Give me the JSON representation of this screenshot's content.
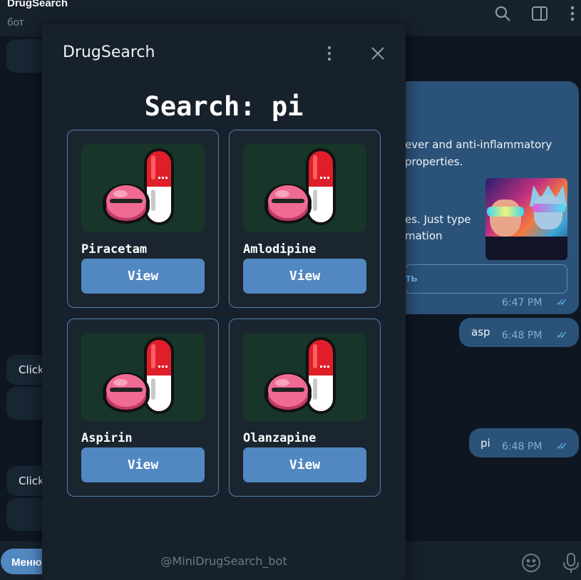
{
  "telegram": {
    "chat_title": "DrugSearch",
    "chat_subtitle": "бот",
    "header_icons": [
      "search-icon",
      "sidebar-toggle-icon",
      "more-vertical-icon"
    ]
  },
  "chat": {
    "bot_message_lines": [
      "ever and anti-inflammatory",
      "properties.",
      "es. Just type",
      "mation"
    ],
    "inline_button_label": "ть",
    "bot_message_time": "6:47 PM",
    "outgoing": [
      {
        "text": "asp",
        "time": "6:48 PM"
      },
      {
        "text": "pi",
        "time": "6:48 PM"
      }
    ],
    "left_bubble_texts": [
      "Click",
      "Click"
    ]
  },
  "input_bar": {
    "menu_label": "Меню",
    "icons": [
      "emoji-icon",
      "microphone-icon"
    ]
  },
  "mini_app": {
    "title": "DrugSearch",
    "heading": "Search: pi",
    "footer": "@MiniDrugSearch_bot",
    "results": [
      {
        "name": "Piracetam",
        "button": "View"
      },
      {
        "name": "Amlodipine",
        "button": "View"
      },
      {
        "name": "Aspirin",
        "button": "View"
      },
      {
        "name": "Olanzapine",
        "button": "View"
      }
    ]
  },
  "colors": {
    "accent": "#5288c1",
    "card_border": "#4f7fb3",
    "image_bg": "#173529",
    "outgoing_bubble": "#2b5278",
    "chat_bg": "#0e1621"
  }
}
